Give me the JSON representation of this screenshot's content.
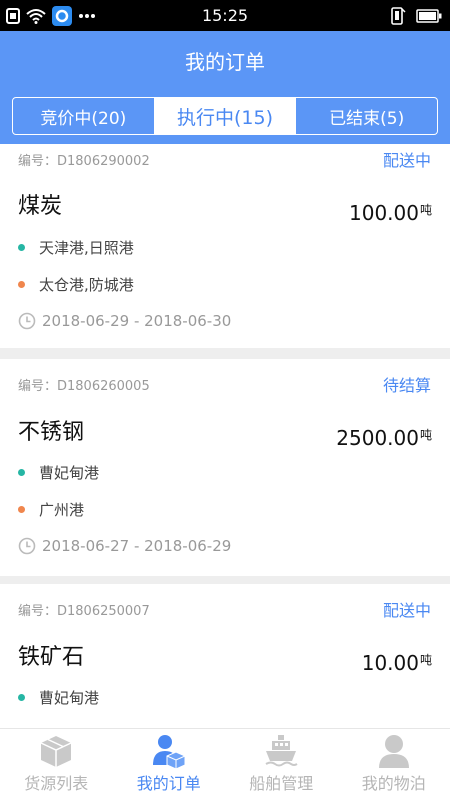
{
  "status_bar": {
    "time": "15:25"
  },
  "header": {
    "title": "我的订单"
  },
  "tabs": [
    {
      "label": "竞价中(20)"
    },
    {
      "label": "执行中(15)"
    },
    {
      "label": "已结束(5)"
    }
  ],
  "orders": [
    {
      "id": "编号：D1806290002",
      "status": "配送中",
      "goods": "煤炭",
      "quantity": "100.00",
      "unit": "吨",
      "loading_port": "天津港,日照港",
      "unloading_port": "太仓港,防城港",
      "date_range": "2018-06-29 - 2018-06-30"
    },
    {
      "id": "编号：D1806260005",
      "status": "待结算",
      "goods": "不锈钢",
      "quantity": "2500.00",
      "unit": "吨",
      "loading_port": "曹妃甸港",
      "unloading_port": "广州港",
      "date_range": "2018-06-27 - 2018-06-29"
    },
    {
      "id": "编号：D1806250007",
      "status": "配送中",
      "goods": "铁矿石",
      "quantity": "10.00",
      "unit": "吨",
      "loading_port": "曹妃甸港"
    }
  ],
  "bottom_nav": [
    {
      "label": "货源列表",
      "icon": "box-icon"
    },
    {
      "label": "我的订单",
      "icon": "person-box-icon"
    },
    {
      "label": "船舶管理",
      "icon": "ship-icon"
    },
    {
      "label": "我的物泊",
      "icon": "user-icon"
    }
  ],
  "colors": {
    "accent": "#5b96f6",
    "link": "#4a88f2",
    "loading_dot": "#26b6a4",
    "unloading_dot": "#f0864d"
  }
}
